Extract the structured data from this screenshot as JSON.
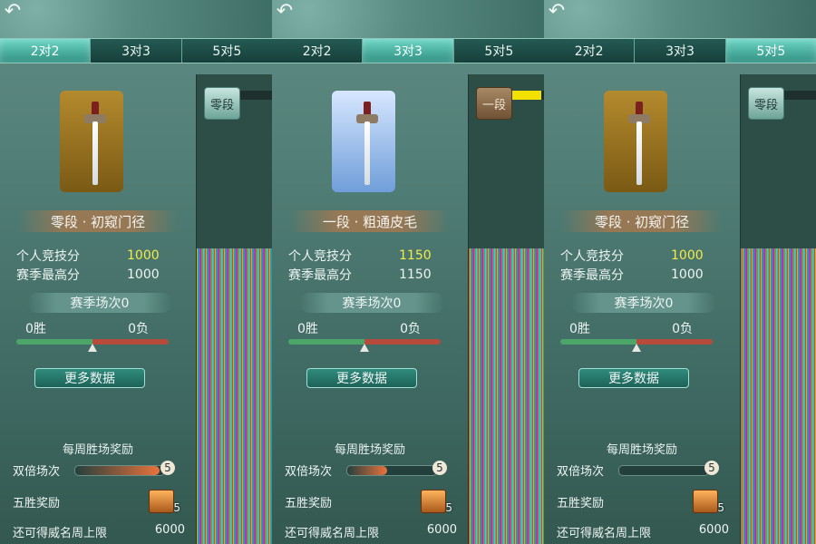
{
  "ui": {
    "back_symbol": "↶"
  },
  "tabs": [
    "2对2",
    "3对3",
    "5对5"
  ],
  "labels": {
    "personal_score": "个人竞技分",
    "season_best": "赛季最高分",
    "more_data": "更多数据",
    "weekly_reward": "每周胜场奖励",
    "double_games": "双倍场次",
    "five_wins": "五胜奖励",
    "weekly_limit": "还可得威名周上限"
  },
  "panels": [
    {
      "active_tab": 0,
      "badge": {
        "style": "gold",
        "icon": "sword-banner-icon"
      },
      "rank_title": "零段 · 初窥门径",
      "personal_score": "1000",
      "season_best": "1000",
      "season_games": "赛季场次0",
      "wins": "0胜",
      "losses": "0负",
      "win_ratio": 0.5,
      "double_games_count": "5",
      "double_progress": 0.95,
      "five_win_chest_count": "5",
      "weekly_limit_value": "6000",
      "rank_tag": {
        "label": "零段",
        "style": "jade"
      },
      "rank_progress": 0.0
    },
    {
      "active_tab": 1,
      "badge": {
        "style": "blue",
        "icon": "sword-banner-icon"
      },
      "rank_title": "一段 · 粗通皮毛",
      "personal_score": "1150",
      "season_best": "1150",
      "season_games": "赛季场次0",
      "wins": "0胜",
      "losses": "0负",
      "win_ratio": 0.5,
      "double_games_count": "5",
      "double_progress": 0.45,
      "five_win_chest_count": "5",
      "weekly_limit_value": "6000",
      "rank_tag": {
        "label": "一段",
        "style": "wood"
      },
      "rank_progress": 0.9
    },
    {
      "active_tab": 2,
      "badge": {
        "style": "gold",
        "icon": "sword-banner-icon"
      },
      "rank_title": "零段 · 初窥门径",
      "personal_score": "1000",
      "season_best": "1000",
      "season_games": "赛季场次0",
      "wins": "0胜",
      "losses": "0负",
      "win_ratio": 0.5,
      "double_games_count": "5",
      "double_progress": 0.0,
      "five_win_chest_count": "5",
      "weekly_limit_value": "6000",
      "rank_tag": {
        "label": "零段",
        "style": "jade"
      },
      "rank_progress": 0.0
    }
  ]
}
